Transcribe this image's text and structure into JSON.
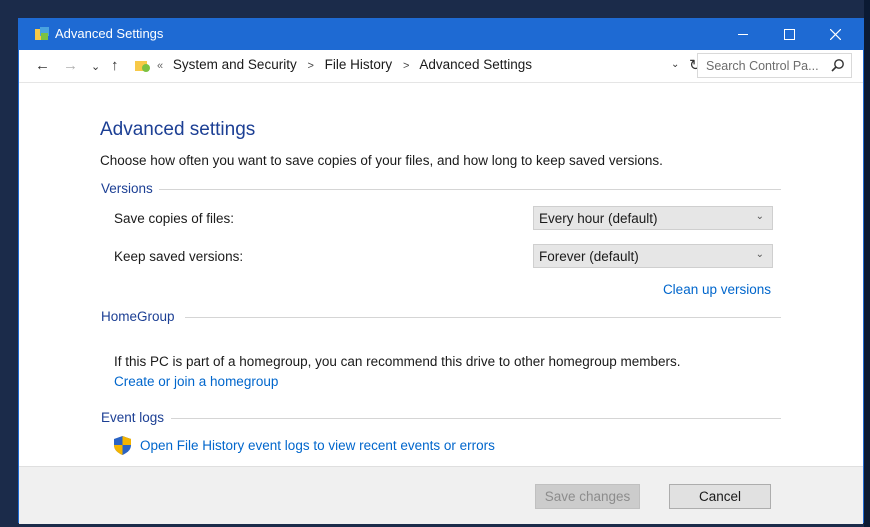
{
  "window": {
    "title": "Advanced Settings",
    "accent_color": "#1e6ad3"
  },
  "navbar": {
    "breadcrumb": [
      "System and Security",
      "File History",
      "Advanced Settings"
    ],
    "lead_chevron": "«",
    "search_placeholder": "Search Control Pa..."
  },
  "page": {
    "title": "Advanced settings",
    "intro": "Choose how often you want to save copies of your files, and how long to keep saved versions."
  },
  "versions": {
    "heading": "Versions",
    "save_copies_label": "Save copies of files:",
    "save_copies_value": "Every hour (default)",
    "keep_versions_label": "Keep saved versions:",
    "keep_versions_value": "Forever (default)",
    "cleanup_link": "Clean up versions"
  },
  "homegroup": {
    "heading": "HomeGroup",
    "text": "If this PC is part of a homegroup, you can recommend this drive to other homegroup members.",
    "link": "Create or join a homegroup"
  },
  "event_logs": {
    "heading": "Event logs",
    "link": "Open File History event logs to view recent events or errors"
  },
  "footer": {
    "save_label": "Save changes",
    "cancel_label": "Cancel"
  },
  "icons": {
    "app": "control-panel-icon",
    "shield": "uac-shield-icon"
  }
}
